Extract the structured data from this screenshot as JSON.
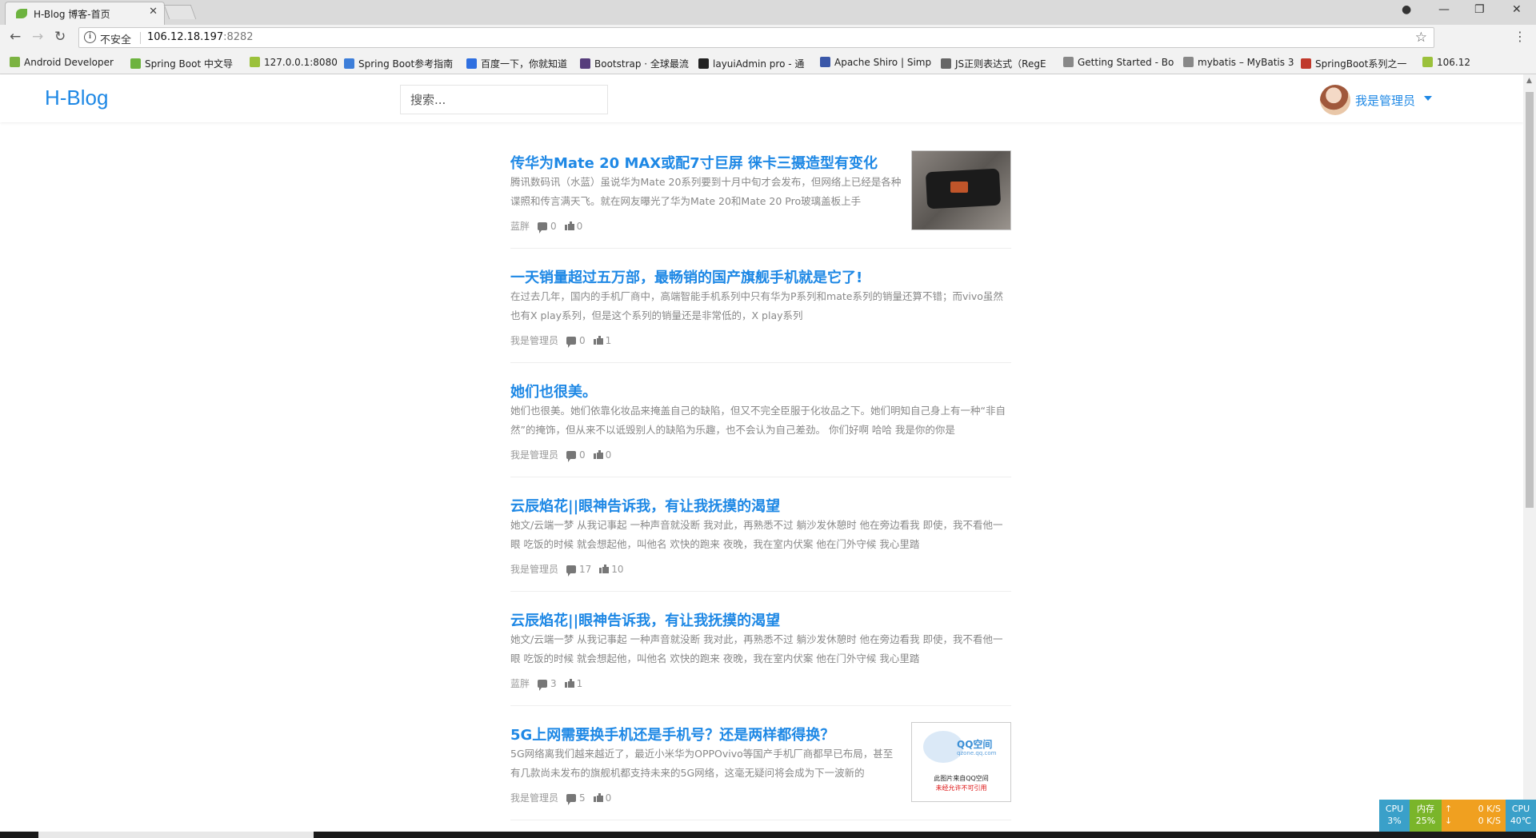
{
  "browser": {
    "tab_title": "H-Blog 博客-首页",
    "tab_close": "✕",
    "security_label": "不安全",
    "url_host": "106.12.18.197",
    "url_port": ":8282",
    "bookmarks": [
      {
        "label": "Android Developer",
        "color": "#7cb342"
      },
      {
        "label": "Spring Boot 中文导",
        "color": "#6db33f"
      },
      {
        "label": "127.0.0.1:8080",
        "color": "#9bc13b"
      },
      {
        "label": "Spring Boot参考指南",
        "color": "#3d7ed9"
      },
      {
        "label": "百度一下，你就知道",
        "color": "#2f6fe0"
      },
      {
        "label": "Bootstrap · 全球最流",
        "color": "#563d7c"
      },
      {
        "label": "layuiAdmin pro - 通",
        "color": "#222222"
      },
      {
        "label": "Apache Shiro | Simp",
        "color": "#3a57a8"
      },
      {
        "label": "JS正则表达式（RegE",
        "color": "#666666"
      },
      {
        "label": "Getting Started - Bo",
        "color": "#888888"
      },
      {
        "label": "mybatis – MyBatis 3",
        "color": "#888888"
      },
      {
        "label": "SpringBoot系列之一",
        "color": "#c0392b"
      },
      {
        "label": "106.12",
        "color": "#9bc13b"
      }
    ]
  },
  "header": {
    "brand": "H-Blog",
    "search_placeholder": "搜索...",
    "user_name": "我是管理员"
  },
  "posts": [
    {
      "title": "传华为Mate 20 MAX或配7寸巨屏 徕卡三摄造型有变化",
      "summary": "腾讯数码讯（水蓝）虽说华为Mate 20系列要到十月中旬才会发布，但网络上已经是各种谍照和传言满天飞。就在网友曝光了华为Mate 20和Mate 20 Pro玻璃盖板上手",
      "author": "蓝胖",
      "comments": "0",
      "likes": "0",
      "thumbnail": "phone-photo"
    },
    {
      "title": "一天销量超过五万部，最畅销的国产旗舰手机就是它了!",
      "summary": "在过去几年，国内的手机厂商中，高端智能手机系列中只有华为P系列和mate系列的销量还算不错；而vivo虽然也有X play系列，但是这个系列的销量还是非常低的，X play系列",
      "author": "我是管理员",
      "comments": "0",
      "likes": "1",
      "thumbnail": ""
    },
    {
      "title": "她们也很美。",
      "summary": "她们也很美。她们依靠化妆品来掩盖自己的缺陷，但又不完全臣服于化妆品之下。她们明知自己身上有一种“非自然”的掩饰，但从来不以诋毁别人的缺陷为乐趣，也不会认为自己差劲。 你们好啊 哈哈 我是你的你是",
      "author": "我是管理员",
      "comments": "0",
      "likes": "0",
      "thumbnail": ""
    },
    {
      "title": "云辰焰花||眼神告诉我，有让我抚摸的渴望",
      "summary": "她文/云端一梦 从我记事起 一种声音就没断 我对此，再熟悉不过 躺沙发休憩时 他在旁边看我 即使，我不看他一眼 吃饭的时候 就会想起他，叫他名 欢快的跑来 夜晚，我在室内伏案 他在门外守候 我心里踏",
      "author": "我是管理员",
      "comments": "17",
      "likes": "10",
      "thumbnail": ""
    },
    {
      "title": "云辰焰花||眼神告诉我，有让我抚摸的渴望",
      "summary": "她文/云端一梦 从我记事起 一种声音就没断 我对此，再熟悉不过 躺沙发休憩时 他在旁边看我 即使，我不看他一眼 吃饭的时候 就会想起他，叫他名 欢快的跑来 夜晚，我在室内伏案 他在门外守候 我心里踏",
      "author": "蓝胖",
      "comments": "3",
      "likes": "1",
      "thumbnail": ""
    },
    {
      "title": "5G上网需要换手机还是手机号？还是两样都得换？",
      "summary": "5G网络离我们越来越近了，最近小米华为OPPOvivo等国产手机厂商都早已布局，甚至有几款尚未发布的旗舰机都支持未来的5G网络，这毫无疑问将会成为下一波新的",
      "author": "我是管理员",
      "comments": "5",
      "likes": "0",
      "thumbnail": "qq-placeholder",
      "thumb_text": {
        "logo": "QQ空间",
        "sub": "qzone.qq.com",
        "note1": "此图片来自QQ空间",
        "note2": "未经允许不可引用"
      }
    }
  ],
  "monitor": {
    "cpu_label": "CPU",
    "cpu_value": "3%",
    "mem_label": "内存",
    "mem_value": "25%",
    "up_speed": "0 K/S",
    "down_speed": "0 K/S",
    "temp_label": "CPU",
    "temp_value": "40℃",
    "colors": {
      "cpu": "#3aa0c9",
      "mem": "#7ab52a",
      "net": "#f0a020",
      "temp": "#3aa0c9"
    }
  }
}
